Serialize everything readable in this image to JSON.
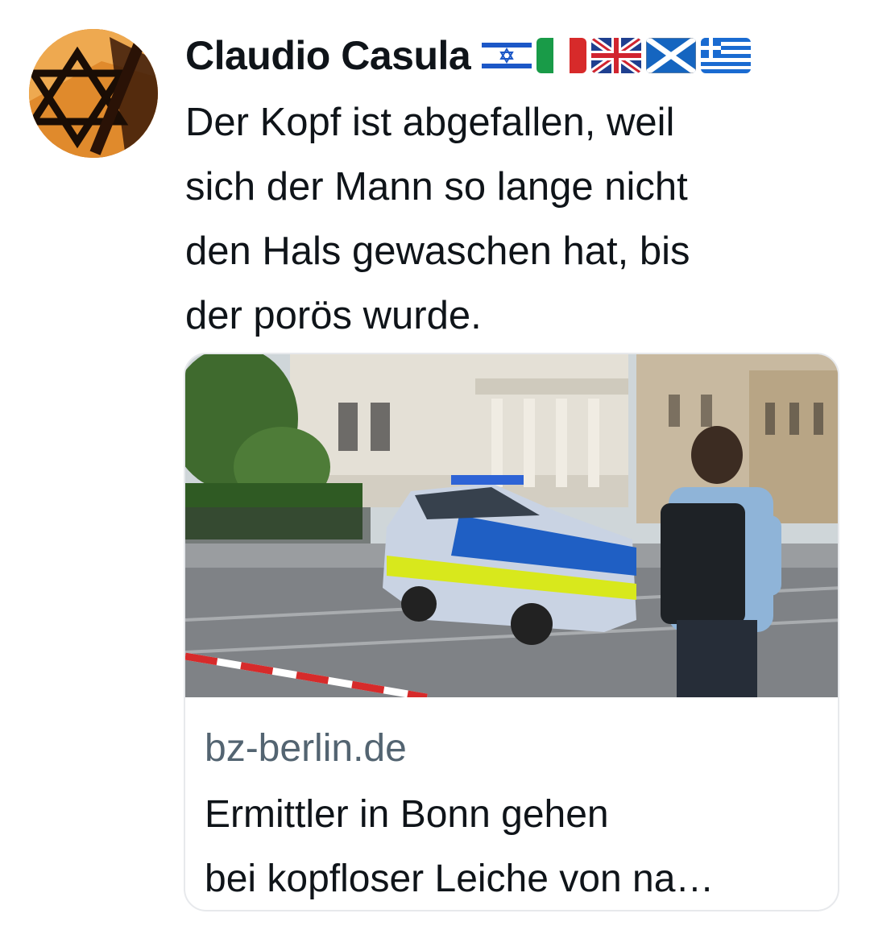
{
  "tweet": {
    "author_name": "Claudio Casula",
    "flags": [
      "israel-flag-icon",
      "italy-flag-icon",
      "uk-flag-icon",
      "scotland-flag-icon",
      "greece-flag-icon"
    ],
    "text": "Der Kopf ist abgefallen, weil\nsich der Mann so lange nicht\nden Hals gewaschen hat, bis\nder porös wurde."
  },
  "link_card": {
    "image": "police-van-photo",
    "domain": "bz-berlin.de",
    "title": "Ermittler in Bonn gehen\nbei kopfloser Leiche von na…"
  },
  "colors": {
    "text_primary": "#0f1419",
    "text_secondary": "#536471",
    "card_border": "#e7e9ec",
    "police_blue": "#1f5fc4",
    "police_yellow": "#d8e81c"
  }
}
